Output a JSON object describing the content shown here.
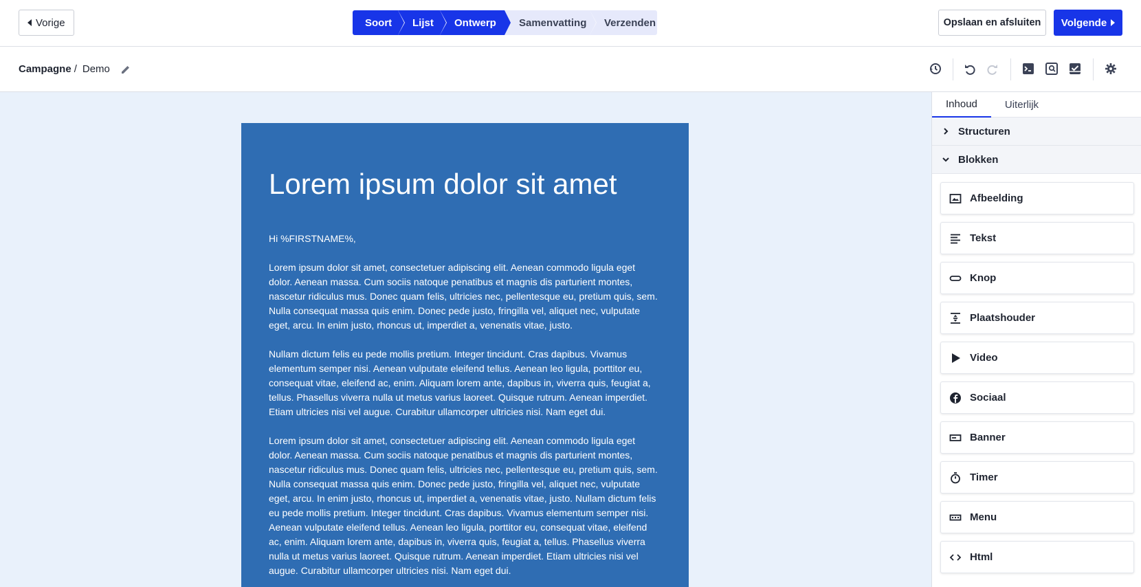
{
  "topbar": {
    "prev_label": "Vorige",
    "steps": [
      {
        "label": "Soort",
        "state": "done"
      },
      {
        "label": "Lijst",
        "state": "done"
      },
      {
        "label": "Ontwerp",
        "state": "done"
      },
      {
        "label": "Samenvatting",
        "state": "todo"
      },
      {
        "label": "Verzenden",
        "state": "todo"
      }
    ],
    "save_label": "Opslaan en afsluiten",
    "next_label": "Volgende"
  },
  "breadcrumb": {
    "root": "Campagne",
    "separator": "/",
    "page": "Demo"
  },
  "toolbar_icons": [
    "history-icon",
    "undo-icon",
    "redo-icon",
    "code-preview-icon",
    "search-preview-icon",
    "test-icon",
    "settings-icon"
  ],
  "email": {
    "title": "Lorem ipsum dolor sit amet",
    "greeting": "Hi %FIRSTNAME%,",
    "paragraphs": [
      "Lorem ipsum dolor sit amet, consectetuer adipiscing elit. Aenean commodo ligula eget dolor. Aenean massa. Cum sociis natoque penatibus et magnis dis parturient montes, nascetur ridiculus mus. Donec quam felis, ultricies nec, pellentesque eu, pretium quis, sem. Nulla consequat massa quis enim. Donec pede justo, fringilla vel, aliquet nec, vulputate eget, arcu. In enim justo, rhoncus ut, imperdiet a, venenatis vitae, justo.",
      "Nullam dictum felis eu pede mollis pretium. Integer tincidunt. Cras dapibus. Vivamus elementum semper nisi. Aenean vulputate eleifend tellus. Aenean leo ligula, porttitor eu, consequat vitae, eleifend ac, enim. Aliquam lorem ante, dapibus in, viverra quis, feugiat a, tellus. Phasellus viverra nulla ut metus varius laoreet. Quisque rutrum. Aenean imperdiet. Etiam ultricies nisi vel augue. Curabitur ullamcorper ultricies nisi. Nam eget dui.",
      "Lorem ipsum dolor sit amet, consectetuer adipiscing elit. Aenean commodo ligula eget dolor. Aenean massa. Cum sociis natoque penatibus et magnis dis parturient montes, nascetur ridiculus mus. Donec quam felis, ultricies nec, pellentesque eu, pretium quis, sem. Nulla consequat massa quis enim. Donec pede justo, fringilla vel, aliquet nec, vulputate eget, arcu. In enim justo, rhoncus ut, imperdiet a, venenatis vitae, justo. Nullam dictum felis eu pede mollis pretium. Integer tincidunt. Cras dapibus. Vivamus elementum semper nisi. Aenean vulputate eleifend tellus. Aenean leo ligula, porttitor eu, consequat vitae, eleifend ac, enim. Aliquam lorem ante, dapibus in, viverra quis, feugiat a, tellus. Phasellus viverra nulla ut metus varius laoreet. Quisque rutrum. Aenean imperdiet. Etiam ultricies nisi vel augue. Curabitur ullamcorper ultricies nisi. Nam eget dui."
    ]
  },
  "panel": {
    "tabs": [
      {
        "label": "Inhoud",
        "active": true
      },
      {
        "label": "Uiterlijk",
        "active": false
      }
    ],
    "sections": {
      "structures": "Structuren",
      "blocks": "Blokken"
    },
    "blocks": [
      {
        "label": "Afbeelding",
        "icon": "image-icon"
      },
      {
        "label": "Tekst",
        "icon": "text-icon"
      },
      {
        "label": "Knop",
        "icon": "button-icon"
      },
      {
        "label": "Plaatshouder",
        "icon": "spacer-icon"
      },
      {
        "label": "Video",
        "icon": "video-icon"
      },
      {
        "label": "Sociaal",
        "icon": "facebook-icon"
      },
      {
        "label": "Banner",
        "icon": "banner-icon"
      },
      {
        "label": "Timer",
        "icon": "timer-icon"
      },
      {
        "label": "Menu",
        "icon": "menu-icon"
      },
      {
        "label": "Html",
        "icon": "code-icon"
      }
    ]
  },
  "colors": {
    "primary": "#1835e8",
    "step_todo_bg": "#e6e9fb",
    "canvas_bg": "#e9f1fb",
    "email_bg": "#2f6db3"
  }
}
